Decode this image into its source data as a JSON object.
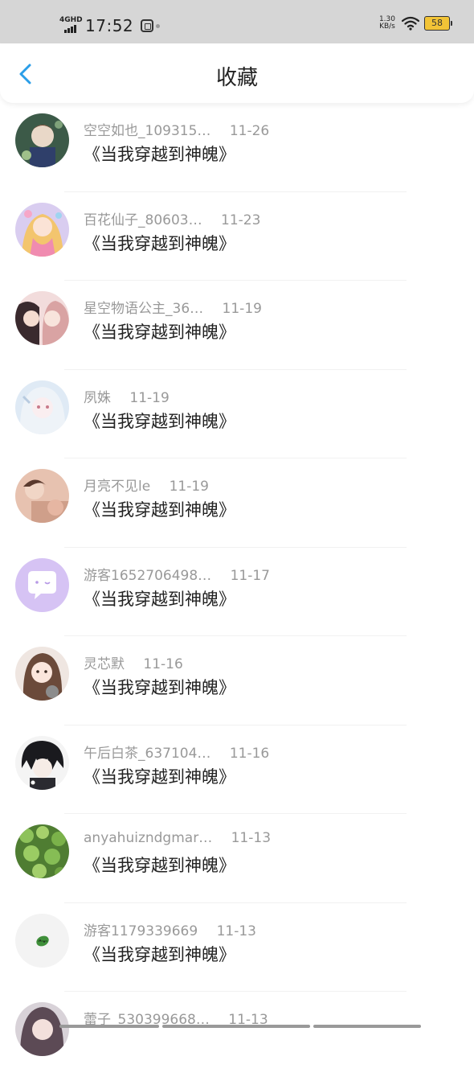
{
  "status_bar": {
    "network": "4GHD",
    "time": "17:52",
    "speed_value": "1.30",
    "speed_unit": "KB/s",
    "battery": "58"
  },
  "header": {
    "title": "收藏",
    "back_icon": "chevron-left-icon",
    "accent_color": "#2a9ee8"
  },
  "favorites": [
    {
      "name": "空空如也_109315…",
      "date": "11-26",
      "book": "《当我穿越到神魄》"
    },
    {
      "name": "百花仙子_80603…",
      "date": "11-23",
      "book": "《当我穿越到神魄》"
    },
    {
      "name": "星空物语公主_36…",
      "date": "11-19",
      "book": "《当我穿越到神魄》"
    },
    {
      "name": "夙姝",
      "date": "11-19",
      "book": "《当我穿越到神魄》"
    },
    {
      "name": "月亮不见le",
      "date": "11-19",
      "book": "《当我穿越到神魄》"
    },
    {
      "name": "游客1652706498…",
      "date": "11-17",
      "book": "《当我穿越到神魄》"
    },
    {
      "name": "灵芯默",
      "date": "11-16",
      "book": "《当我穿越到神魄》"
    },
    {
      "name": "午后白茶_637104…",
      "date": "11-16",
      "book": "《当我穿越到神魄》"
    },
    {
      "name": "anyahuizndgmar…",
      "date": "11-13",
      "book": "《当我穿越到神魄》"
    },
    {
      "name": "游客1179339669",
      "date": "11-13",
      "book": "《当我穿越到神魄》"
    },
    {
      "name": "蕾子_530399668…",
      "date": "11-13",
      "book": ""
    }
  ]
}
